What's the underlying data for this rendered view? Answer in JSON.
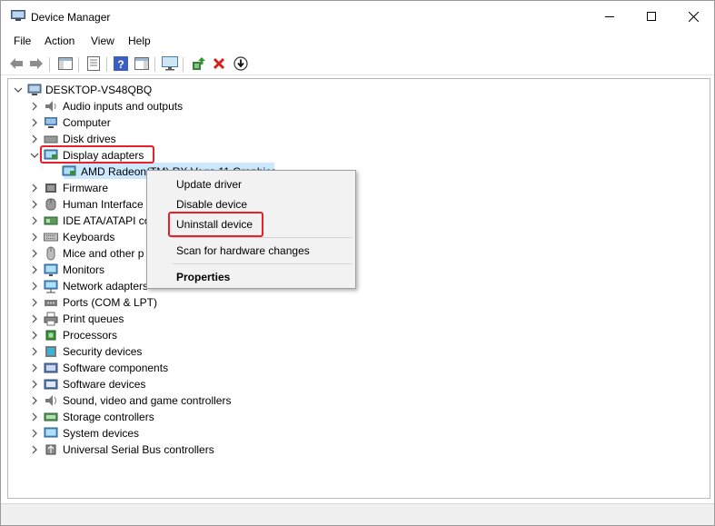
{
  "window": {
    "title": "Device Manager",
    "controls": {
      "minimize": "minimize-icon",
      "maximize": "maximize-icon",
      "close": "close-icon"
    }
  },
  "menu": [
    "File",
    "Action",
    "View",
    "Help"
  ],
  "toolbar": {
    "buttons": [
      {
        "name": "back",
        "icon": "back-arrow-icon"
      },
      {
        "name": "forward",
        "icon": "forward-arrow-icon"
      },
      {
        "name": "show-hide-console-tree",
        "icon": "console-tree-icon"
      },
      {
        "name": "properties",
        "icon": "properties-icon"
      },
      {
        "name": "help",
        "icon": "help-icon"
      },
      {
        "name": "action-pane",
        "icon": "action-pane-icon"
      },
      {
        "name": "scan-hardware",
        "icon": "monitor-scan-icon"
      },
      {
        "name": "update-driver",
        "icon": "update-driver-icon"
      },
      {
        "name": "uninstall-device",
        "icon": "red-x-icon"
      },
      {
        "name": "enable-device",
        "icon": "download-circle-icon"
      }
    ]
  },
  "tree": {
    "root": "DESKTOP-VS48QBQ",
    "categories": [
      "Audio inputs and outputs",
      "Computer",
      "Disk drives",
      "Display adapters",
      "Firmware",
      "Human Interface",
      "IDE ATA/ATAPI co",
      "Keyboards",
      "Mice and other p",
      "Monitors",
      "Network adapters",
      "Ports (COM & LPT)",
      "Print queues",
      "Processors",
      "Security devices",
      "Software components",
      "Software devices",
      "Sound, video and game controllers",
      "Storage controllers",
      "System devices",
      "Universal Serial Bus controllers"
    ],
    "expanded_child": "AMD Radeon(TM) RX Vega 11 Graphics"
  },
  "context_menu": {
    "items": [
      "Update driver",
      "Disable device",
      "Uninstall device",
      "Scan for hardware changes",
      "Properties"
    ]
  },
  "colors": {
    "highlight_red": "#e8202a",
    "selection_blue": "#cce8ff",
    "menu_bg": "#f2f2f2"
  }
}
